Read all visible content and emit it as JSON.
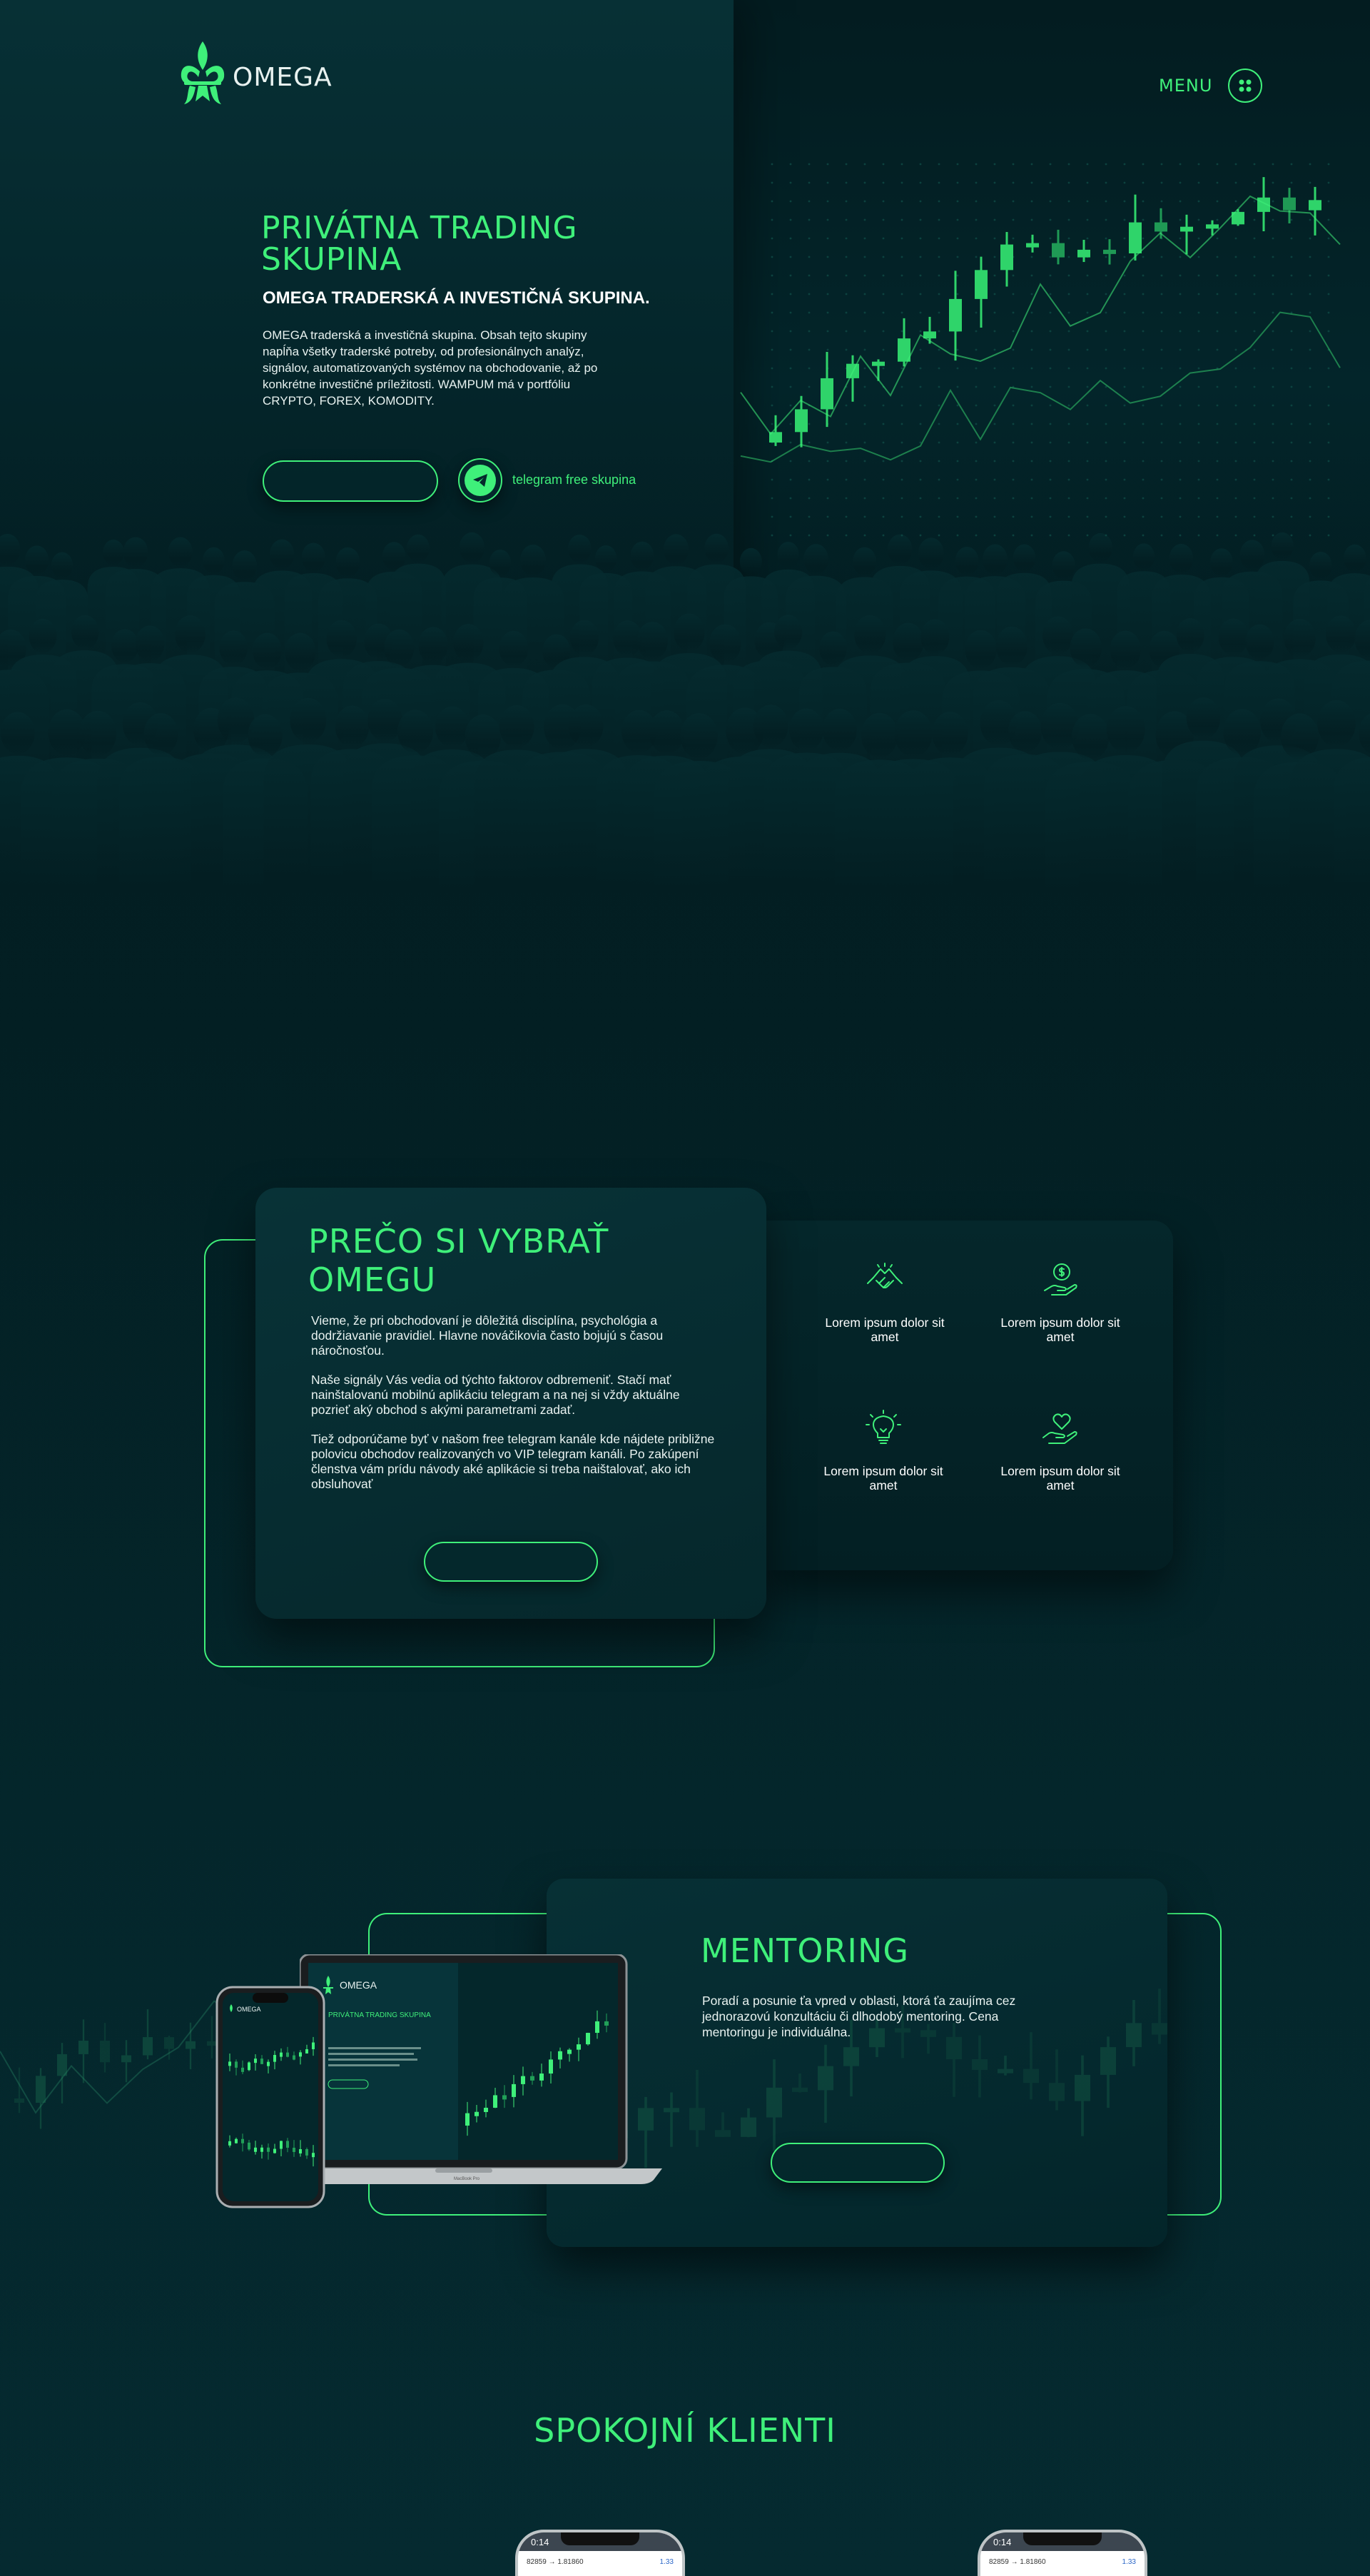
{
  "brand": {
    "name": "OMEGA",
    "accent": "#3ff07a",
    "background": "#031f23"
  },
  "nav": {
    "menu_label": "MENU",
    "menu_icon": "grid-dots-icon"
  },
  "hero": {
    "title": "PRIVÁTNA TRADING SKUPINA",
    "subtitle": "OMEGA TRADERSKÁ A INVESTIČNÁ SKUPINA.",
    "description": "OMEGA traderská a investičná skupina. Obsah tejto skupiny napĺňa všetky traderské potreby, od profesionálnych analýz, signálov, automatizovaných systémov na obchodovanie, až po konkrétne investičné príležitosti. WAMPUM má v portfóliu CRYPTO, FOREX, KOMODITY.",
    "cta_label": "",
    "telegram_label": "telegram free skupina",
    "telegram_icon": "telegram-paper-plane-icon"
  },
  "why": {
    "title": "PREČO SI VYBRAŤ OMEGU",
    "paragraphs": [
      "Vieme, že pri obchodovaní je dôležitá disciplína, psychológia a dodržiavanie pravidiel. Hlavne nováčikovia často bojujú s časou náročnosťou.",
      "Naše signály Vás vedia od týchto faktorov odbremeniť. Stačí mať nainštalovanú mobilnú aplikáciu telegram a na nej si vždy aktuálne pozrieť aký obchod s akými parametrami zadať.",
      "Tiež odporúčame byť v našom free telegram kanále kde nájdete približne polovicu obchodov realizovaných vo VIP telegram kanáli. Po zakúpení členstva vám prídu návody aké aplikácie si treba naištalovať, ako ich obsluhovať"
    ],
    "cta_label": "",
    "features": [
      {
        "icon": "handshake-icon",
        "label": "Lorem ipsum dolor sit amet"
      },
      {
        "icon": "money-hand-icon",
        "label": "Lorem ipsum dolor sit amet"
      },
      {
        "icon": "lightbulb-icon",
        "label": "Lorem ipsum dolor sit amet"
      },
      {
        "icon": "heart-hand-icon",
        "label": "Lorem ipsum dolor sit amet"
      }
    ]
  },
  "mentoring": {
    "title": "MENTORING",
    "text": "Poradí a posunie ťa vpred v oblasti, ktorá ťa zaujíma cez jednorazovú konzultáciu či dlhodobý mentoring. Cena mentoringu je individuálna.",
    "cta_label": "",
    "mockup": {
      "brand": "OMEGA",
      "title": "PRIVÁTNA TRADING SKUPINA",
      "laptop_label": "MacBook Pro"
    }
  },
  "clients": {
    "title": "SPOKOJNÍ KLIENTI",
    "phones": [
      {
        "time": "0:14",
        "quote_left": "82859 → 1.81860",
        "quote_right": "1.33"
      },
      {
        "time": "0:14",
        "quote_left": "82859 → 1.81860",
        "quote_right": "1.33"
      }
    ]
  }
}
